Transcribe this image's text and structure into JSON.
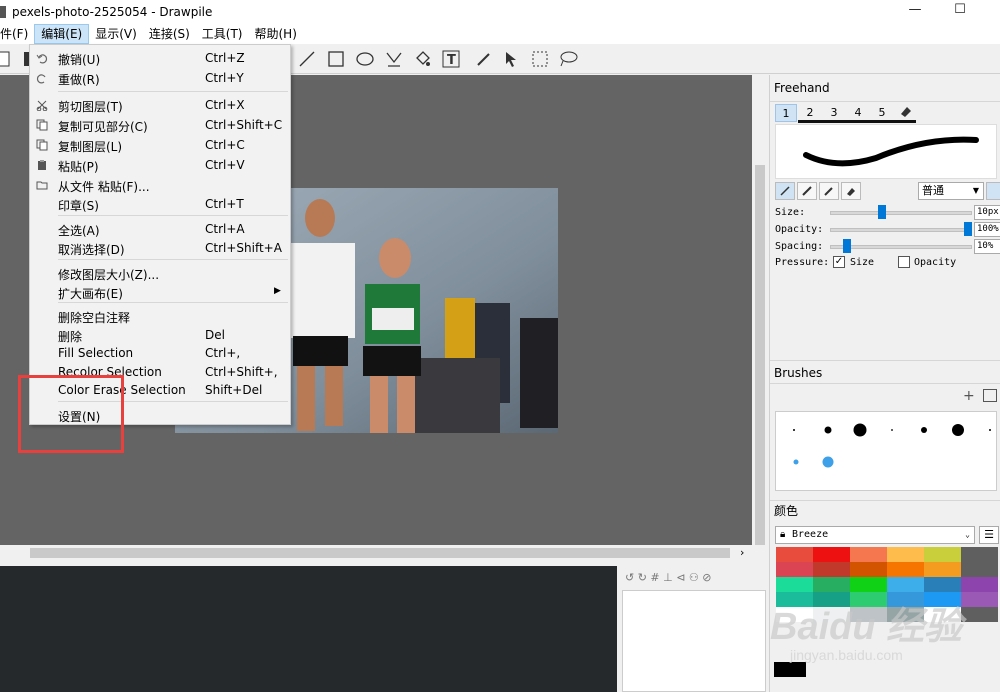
{
  "window": {
    "title": "pexels-photo-2525054 - Drawpile",
    "minimize": "—",
    "maximize": "☐"
  },
  "menubar": [
    "件(F)",
    "编辑(E)",
    "显示(V)",
    "连接(S)",
    "工具(T)",
    "帮助(H)"
  ],
  "edit_menu": {
    "items": [
      {
        "label": "撤销(U)",
        "shortcut": "Ctrl+Z",
        "icon": "undo-icon"
      },
      {
        "label": "重做(R)",
        "shortcut": "Ctrl+Y",
        "icon": "redo-icon"
      },
      {
        "label": "剪切图层(T)",
        "shortcut": "Ctrl+X",
        "icon": "cut-icon"
      },
      {
        "label": "复制可见部分(C)",
        "shortcut": "Ctrl+Shift+C",
        "icon": "copy-visible-icon"
      },
      {
        "label": "复制图层(L)",
        "shortcut": "Ctrl+C",
        "icon": "copy-icon"
      },
      {
        "label": "粘贴(P)",
        "shortcut": "Ctrl+V",
        "icon": "paste-icon"
      },
      {
        "label": "从文件 粘贴(F)...",
        "shortcut": "",
        "icon": "folder-icon"
      },
      {
        "label": "印章(S)",
        "shortcut": "Ctrl+T",
        "icon": ""
      },
      {
        "label": "全选(A)",
        "shortcut": "Ctrl+A",
        "icon": ""
      },
      {
        "label": "取消选择(D)",
        "shortcut": "Ctrl+Shift+A",
        "icon": ""
      },
      {
        "label": "修改图层大小(Z)...",
        "shortcut": "",
        "icon": ""
      },
      {
        "label": "扩大画布(E)",
        "shortcut": "",
        "icon": ""
      },
      {
        "label": "删除空白注释",
        "shortcut": "",
        "icon": ""
      },
      {
        "label": "删除",
        "shortcut": "Del",
        "icon": ""
      },
      {
        "label": "Fill Selection",
        "shortcut": "Ctrl+,",
        "icon": ""
      },
      {
        "label": "Recolor Selection",
        "shortcut": "Ctrl+Shift+,",
        "icon": ""
      },
      {
        "label": "Color Erase Selection",
        "shortcut": "Shift+Del",
        "icon": ""
      },
      {
        "label": "设置(N)",
        "shortcut": "",
        "icon": ""
      }
    ]
  },
  "brush_panel": {
    "title": "Freehand",
    "slots": [
      "1",
      "2",
      "3",
      "4",
      "5"
    ],
    "blend_mode": "普通",
    "size_label": "Size:",
    "size_value": "10px",
    "size_level": 0.36,
    "opacity_label": "Opacity:",
    "opacity_value": "100%",
    "opacity_level": 1.0,
    "spacing_label": "Spacing:",
    "spacing_value": "10%",
    "spacing_level": 0.1,
    "pressure_label": "Pressure:",
    "pressure_size": "Size",
    "pressure_size_checked": true,
    "pressure_opacity": "Opacity",
    "pressure_opacity_checked": false
  },
  "brushes_panel": {
    "title": "Brushes"
  },
  "color_panel": {
    "title": "颜色",
    "palette_name": "Breeze",
    "swatches": [
      "#e74c3c",
      "#ee1111",
      "#f47750",
      "#fdbc4b",
      "#c9ce3b",
      "#5f5f5f",
      "#da4453",
      "#c0392b",
      "#d35400",
      "#f67400",
      "#f39c1f",
      "#5f5f5f",
      "#1cdc9a",
      "#27ae60",
      "#11d116",
      "#3daee9",
      "#2980b9",
      "#8e44ad",
      "#1abc9c",
      "#16a085",
      "#2ecc71",
      "#3498db",
      "#1d99f3",
      "#9b59b6",
      "#ffffff",
      "#eff0f1",
      "#bdc3c7",
      "#95a5a6",
      "#ffffff",
      "#5f5f5f"
    ],
    "current": "#000000"
  },
  "watermark": {
    "brand": "Baidu 经验",
    "url": "jingyan.baidu.com"
  }
}
